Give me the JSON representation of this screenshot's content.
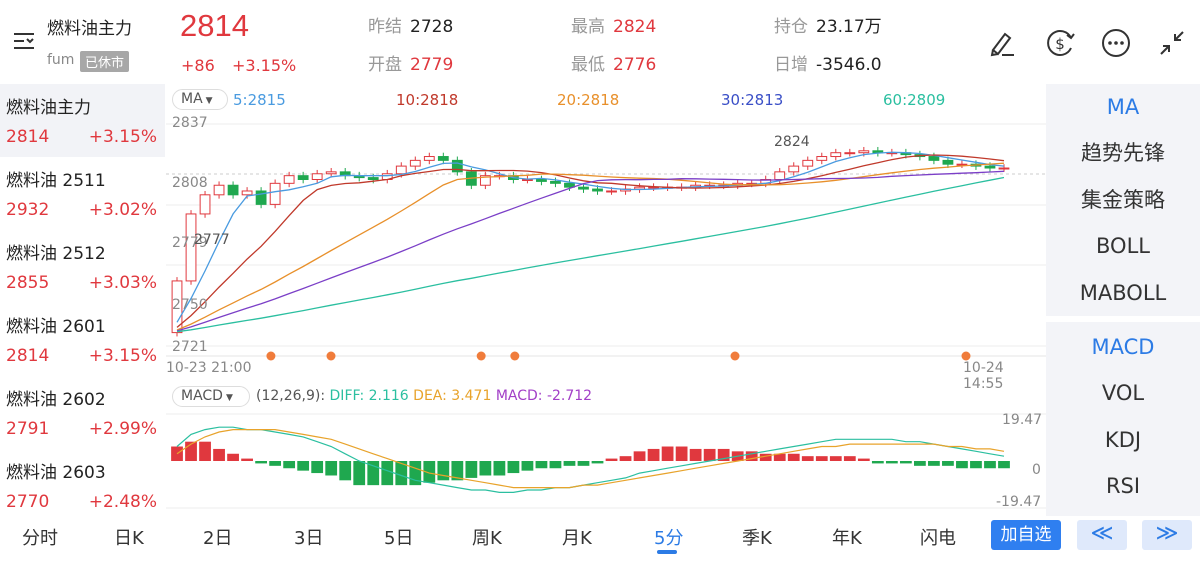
{
  "header": {
    "title": "燃料油主力",
    "code": "fum",
    "status_badge": "已休市",
    "price": "2814",
    "change": "+86",
    "change_pct": "+3.15%",
    "stats": {
      "prev_close_label": "昨结",
      "prev_close": "2728",
      "open_label": "开盘",
      "open": "2779",
      "high_label": "最高",
      "high": "2824",
      "low_label": "最低",
      "low": "2776",
      "oi_label": "持仓",
      "oi": "23.17万",
      "oi_change_label": "日增",
      "oi_change": "-3546.0"
    },
    "icons": [
      "draw-icon",
      "currency-icon",
      "more-icon",
      "collapse-icon"
    ]
  },
  "contracts": [
    {
      "name": "燃料油主力",
      "price": "2814",
      "pct": "+3.15%"
    },
    {
      "name": "燃料油 2511",
      "price": "2932",
      "pct": "+3.02%"
    },
    {
      "name": "燃料油 2512",
      "price": "2855",
      "pct": "+3.03%"
    },
    {
      "name": "燃料油 2601",
      "price": "2814",
      "pct": "+3.15%"
    },
    {
      "name": "燃料油 2602",
      "price": "2791",
      "pct": "+2.99%"
    },
    {
      "name": "燃料油 2603",
      "price": "2770",
      "pct": "+2.48%"
    }
  ],
  "ma_legend": {
    "selector": "MA",
    "ma5": "5:2815",
    "ma10": "10:2818",
    "ma20": "20:2818",
    "ma30": "30:2813",
    "ma60": "60:2809"
  },
  "price_axis": {
    "labels": [
      "2837",
      "2808",
      "2779",
      "2750",
      "2721"
    ],
    "marker_high": "2824",
    "marker_low": "2777"
  },
  "time_axis": {
    "start": "10-23 21:00",
    "end": "10-24 14:55"
  },
  "macd_legend": {
    "selector": "MACD",
    "params": "(12,26,9):",
    "diff": "DIFF: 2.116",
    "dea": "DEA: 3.471",
    "macd": "MACD: -2.712"
  },
  "macd_axis": {
    "top": "19.47",
    "zero": "0",
    "bottom": "-19.47"
  },
  "indicators_main": [
    "MA",
    "趋势先锋",
    "集金策略",
    "BOLL",
    "MABOLL"
  ],
  "indicators_sub": [
    "MACD",
    "VOL",
    "KDJ",
    "RSI"
  ],
  "tabs": [
    "分时",
    "日K",
    "2日",
    "3日",
    "5日",
    "周K",
    "月K",
    "5分",
    "季K",
    "年K",
    "闪电"
  ],
  "active_tab": "5分",
  "buttons": {
    "add_watch": "加自选",
    "prev": "≪",
    "next": "≫"
  },
  "colors": {
    "up": "#e0383e",
    "down": "#1fa84f",
    "ma5": "#4a9be0",
    "ma10": "#c0392b",
    "ma20": "#e8902b",
    "ma30": "#7b3fc7",
    "ma60": "#2bbfa0",
    "accent": "#2c7be5"
  },
  "chart_data": {
    "type": "candlestick",
    "price_range": [
      2721,
      2837
    ],
    "closes": [
      2755,
      2790,
      2800,
      2805,
      2800,
      2802,
      2795,
      2806,
      2810,
      2808,
      2811,
      2812,
      2810,
      2809,
      2808,
      2811,
      2815,
      2818,
      2820,
      2818,
      2812,
      2805,
      2810,
      2810,
      2808,
      2808,
      2807,
      2806,
      2804,
      2803,
      2802,
      2802,
      2803,
      2804,
      2804,
      2804,
      2804,
      2805,
      2805,
      2805,
      2806,
      2806,
      2808,
      2812,
      2815,
      2818,
      2820,
      2822,
      2822,
      2823,
      2822,
      2822,
      2821,
      2820,
      2818,
      2816,
      2816,
      2815,
      2814,
      2814
    ],
    "macd_range": [
      -19.47,
      19.47
    ],
    "diff": [
      6,
      11,
      13,
      14,
      14,
      13,
      13,
      12,
      11,
      10,
      8,
      6,
      3,
      0,
      -2,
      -4,
      -6,
      -8,
      -9,
      -10,
      -11,
      -12,
      -12,
      -13,
      -13,
      -12,
      -12,
      -11,
      -11,
      -10,
      -9,
      -8,
      -7,
      -5,
      -4,
      -3,
      -2,
      -1,
      0,
      1,
      2,
      3,
      4,
      5,
      6,
      7,
      8,
      9,
      9,
      9,
      9,
      9,
      8,
      8,
      7,
      6,
      5,
      4,
      3,
      2
    ],
    "dea": [
      3,
      7,
      10,
      12,
      13,
      13,
      13,
      13,
      12,
      11,
      10,
      9,
      7,
      5,
      3,
      1,
      -1,
      -3,
      -5,
      -6,
      -7,
      -8,
      -9,
      -10,
      -11,
      -11,
      -11,
      -11,
      -11,
      -10,
      -10,
      -9,
      -8,
      -7,
      -6,
      -5,
      -4,
      -3,
      -2,
      -1,
      0,
      1,
      2,
      3,
      4,
      5,
      6,
      6,
      7,
      7,
      7,
      7,
      7,
      7,
      7,
      6,
      6,
      5,
      5,
      4
    ],
    "macd": [
      6,
      8,
      8,
      5,
      3,
      1,
      -1,
      -2,
      -3,
      -4,
      -5,
      -6,
      -8,
      -10,
      -10,
      -10,
      -10,
      -10,
      -9,
      -8,
      -8,
      -7,
      -6,
      -6,
      -5,
      -4,
      -3,
      -3,
      -2,
      -2,
      -1,
      1,
      2,
      4,
      5,
      6,
      6,
      5,
      5,
      5,
      4,
      4,
      3,
      3,
      3,
      2,
      2,
      2,
      2,
      1,
      -1,
      -1,
      -1,
      -2,
      -2,
      -2,
      -3,
      -3,
      -3,
      -3
    ]
  }
}
